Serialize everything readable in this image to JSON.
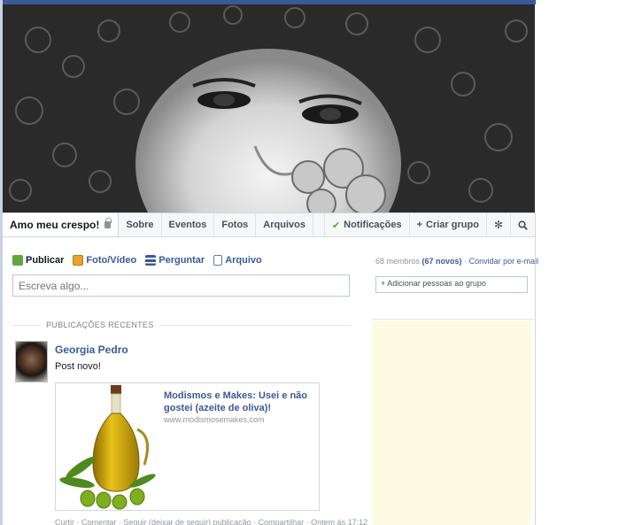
{
  "colors": {
    "facebook_blue": "#3b5998",
    "link_blue": "#3b5998",
    "highlight_yellow": "#fdfbe1"
  },
  "cover": {
    "icon": "cover-photo"
  },
  "group": {
    "name": "Amo meu crespo!",
    "privacy_icon": "lock-icon"
  },
  "tabs": {
    "about": "Sobre",
    "events": "Eventos",
    "photos": "Fotos",
    "files": "Arquivos",
    "notifications": "Notificações",
    "create_group": "Criar grupo",
    "settings_icon": "gear-icon",
    "search_icon": "search-icon"
  },
  "composer": {
    "publish": "Publicar",
    "photo_video": "Foto/Vídeo",
    "ask": "Perguntar",
    "file": "Arquivo",
    "placeholder": "Escreva algo..."
  },
  "feed": {
    "section_title": "PUBLICAÇÕES RECENTES",
    "post": {
      "author": "Georgia Pedro",
      "text": "Post novo!",
      "attachment": {
        "title": "Modismos e Makes: Usei e não gostei (azeite de oliva)!",
        "url": "www.modismosemakes.com",
        "image_icon": "olive-oil-bottle-image"
      },
      "footer": "Curtir · Comentar · Seguir (deixar de seguir) publicação · Compartilhar · Ontem às 17:12"
    }
  },
  "sidebar": {
    "members_count": "68 membros",
    "new_members": "(67 novos)",
    "invite": "Convidar por e-mail",
    "add_people": "Adicionar pessoas ao grupo"
  }
}
